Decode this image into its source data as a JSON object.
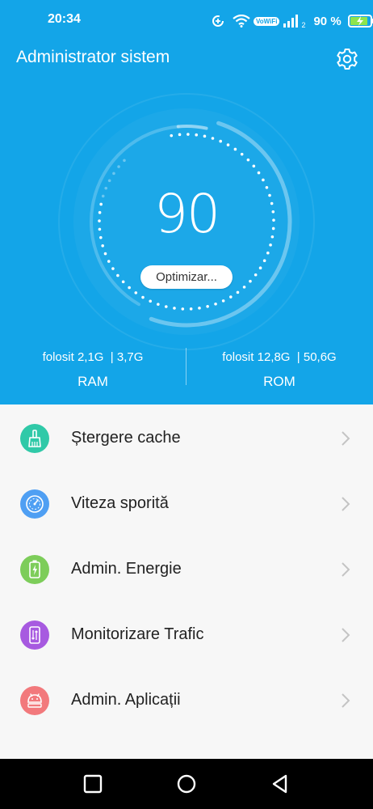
{
  "status_bar": {
    "time": "20:34",
    "vowifi": "VoWiFi",
    "signal_sub": "2",
    "battery_percent_text": "90 %",
    "battery_level": 0.9,
    "icons": [
      "data-saver-icon",
      "wifi-icon",
      "vowifi-badge",
      "signal-icon",
      "battery-charging-icon"
    ]
  },
  "header": {
    "title": "Administrator sistem",
    "settings_icon": "gear-icon",
    "background": "#13a5e8"
  },
  "gauge": {
    "score": "90",
    "score_value": 90,
    "optimize_label": "Optimizar..."
  },
  "memory": {
    "ram": {
      "usage": "folosit 2,1G  | 3,7G",
      "label": "RAM"
    },
    "rom": {
      "usage": "folosit 12,8G  | 50,6G",
      "label": "ROM"
    }
  },
  "menu": [
    {
      "label": "Ștergere cache",
      "icon": "broom-icon",
      "color": "#30c9a8"
    },
    {
      "label": "Viteza sporită",
      "icon": "speedometer-icon",
      "color": "#4f9ff3"
    },
    {
      "label": "Admin. Energie",
      "icon": "battery-icon",
      "color": "#7dcd5a"
    },
    {
      "label": "Monitorizare Trafic",
      "icon": "traffic-icon",
      "color": "#a75ae0"
    },
    {
      "label": "Admin. Aplicații",
      "icon": "android-icon",
      "color": "#f2797c"
    }
  ],
  "nav": [
    "recent-apps-icon",
    "home-icon",
    "back-icon"
  ]
}
